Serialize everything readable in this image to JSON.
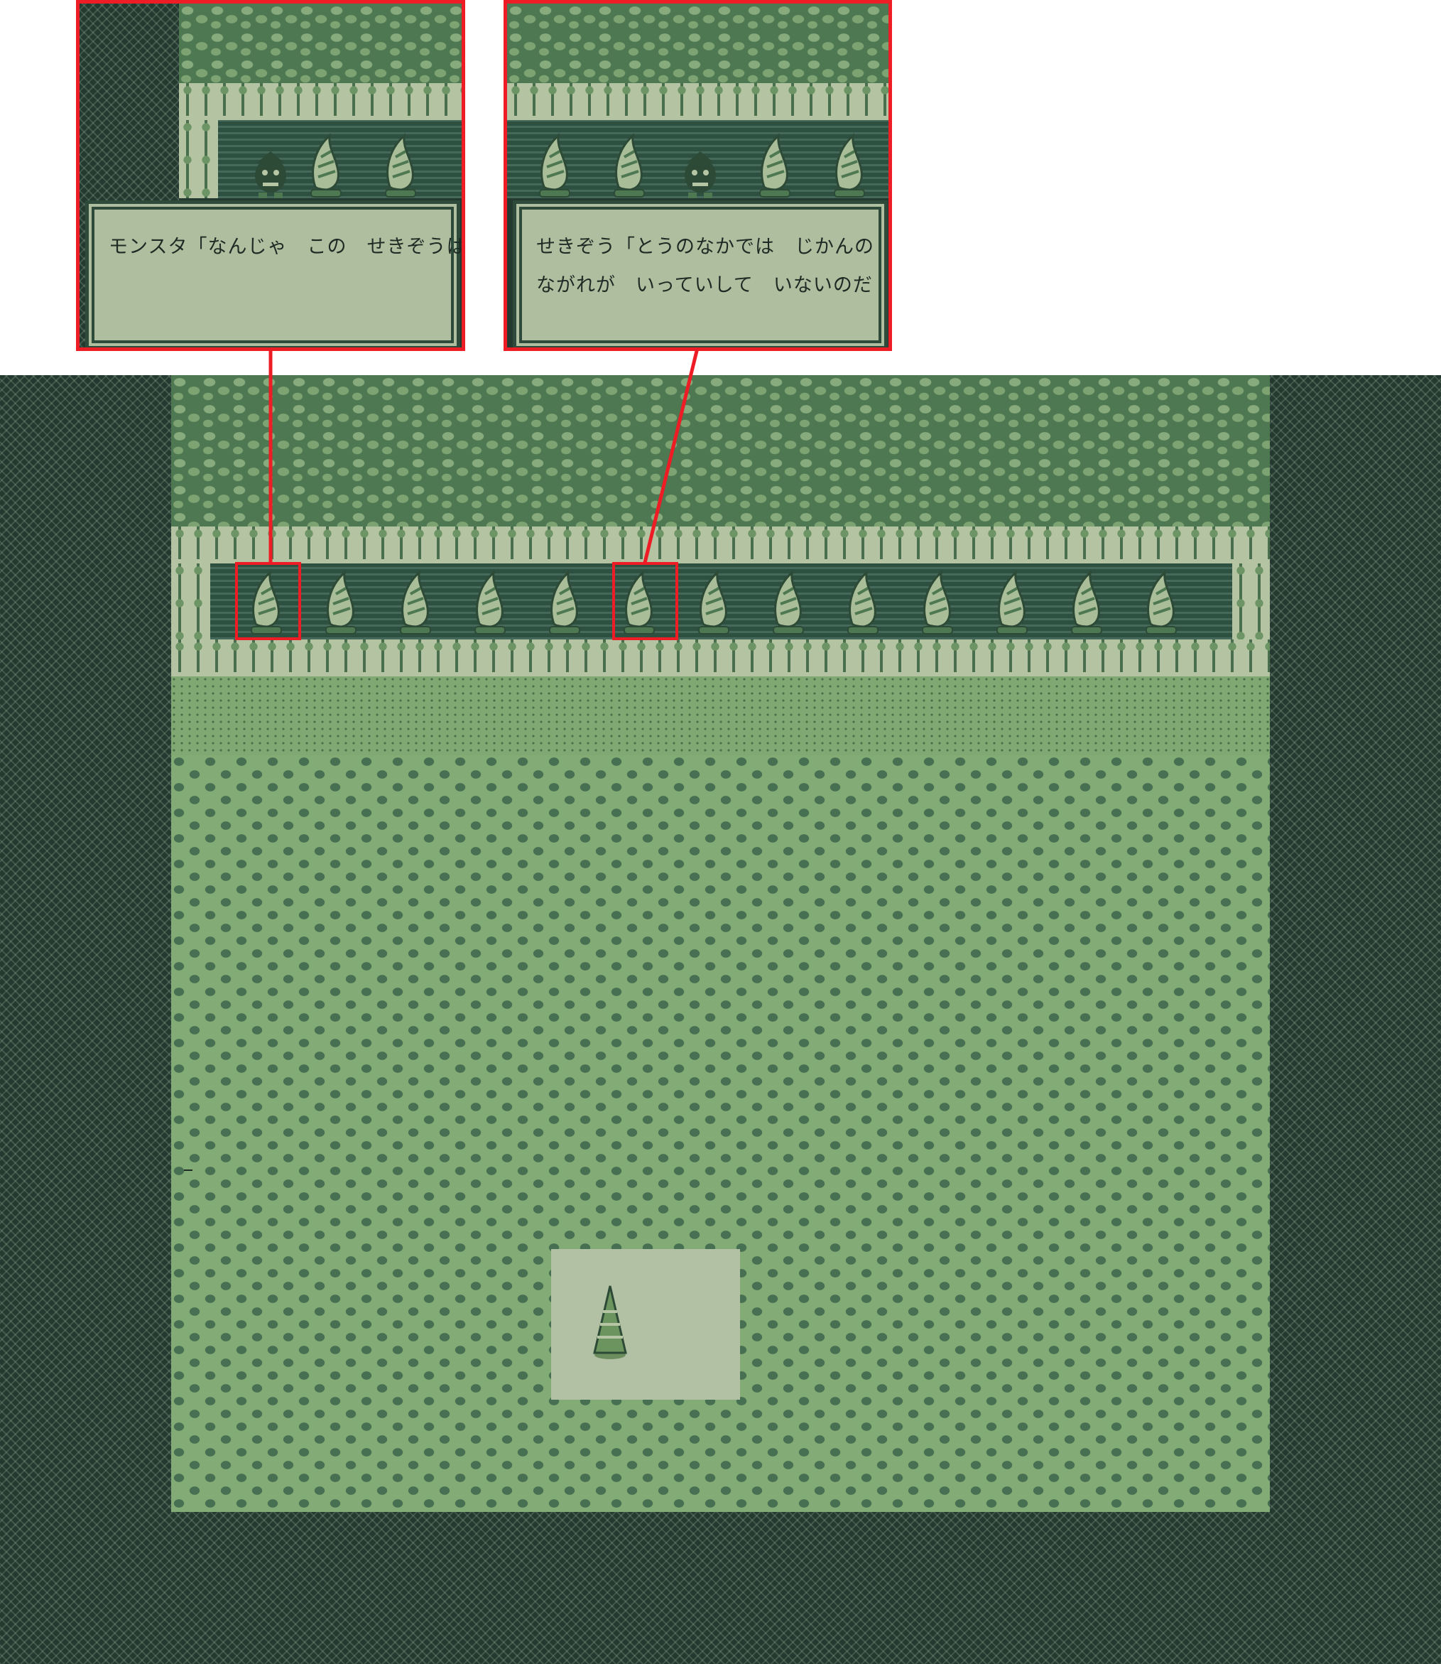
{
  "dialogs": [
    {
      "speaker": "モンスタ",
      "lines": [
        "モンスタ「なんじゃ　この　せきぞうは"
      ]
    },
    {
      "speaker": "せきぞう",
      "lines": [
        "せきぞう「とうのなかでは　じかんの",
        "ながれが　いっていして　いないのだ"
      ]
    }
  ],
  "colors": {
    "frame_red": "#ee1c24",
    "void": "#24392f",
    "rock_light": "#87ab7c",
    "palm_bg": "#b4c4a2",
    "dialog_bg": "#b0bea0",
    "dialog_border": "#2e4a3b"
  },
  "scene": {
    "statue_count": 13,
    "objects": [
      "drill-statue-icon",
      "monster-hero-icon",
      "cone-tree-icon"
    ]
  }
}
